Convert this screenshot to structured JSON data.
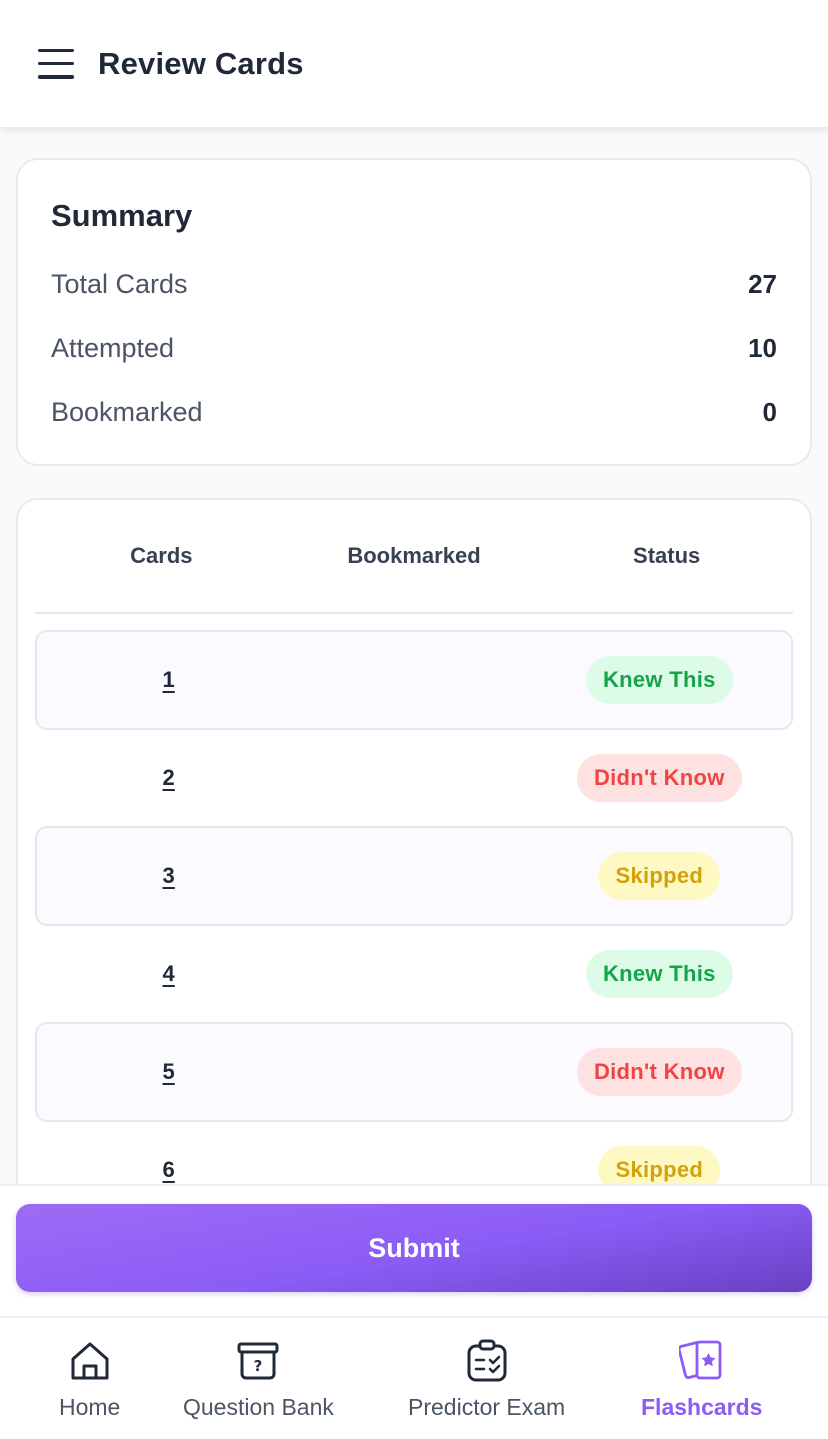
{
  "header": {
    "title": "Review Cards",
    "menu_icon": "menu-icon"
  },
  "summary": {
    "title": "Summary",
    "rows": [
      {
        "label": "Total Cards",
        "value": "27"
      },
      {
        "label": "Attempted",
        "value": "10"
      },
      {
        "label": "Bookmarked",
        "value": "0"
      }
    ]
  },
  "table": {
    "headers": {
      "cards": "Cards",
      "bookmarked": "Bookmarked",
      "status": "Status"
    },
    "rows": [
      {
        "card": "1",
        "bookmarked": "",
        "status": "Knew This"
      },
      {
        "card": "2",
        "bookmarked": "",
        "status": "Didn't Know"
      },
      {
        "card": "3",
        "bookmarked": "",
        "status": "Skipped"
      },
      {
        "card": "4",
        "bookmarked": "",
        "status": "Knew This"
      },
      {
        "card": "5",
        "bookmarked": "",
        "status": "Didn't Know"
      },
      {
        "card": "6",
        "bookmarked": "",
        "status": "Skipped"
      }
    ]
  },
  "submit": {
    "label": "Submit"
  },
  "nav": {
    "items": [
      {
        "label": "Home",
        "icon": "home-icon",
        "active": false
      },
      {
        "label": "Question Bank",
        "icon": "question-bank-icon",
        "active": false
      },
      {
        "label": "Predictor Exam",
        "icon": "predictor-exam-icon",
        "active": false
      },
      {
        "label": "Flashcards",
        "icon": "flashcards-icon",
        "active": true
      }
    ]
  },
  "colors": {
    "accent": "#8b5cf6",
    "knew_bg": "#dcfce7",
    "knew_text": "#16a34a",
    "didnt_bg": "#fee2e2",
    "didnt_text": "#ef4444",
    "skipped_bg": "#fef9c3",
    "skipped_text": "#d4a10a"
  }
}
